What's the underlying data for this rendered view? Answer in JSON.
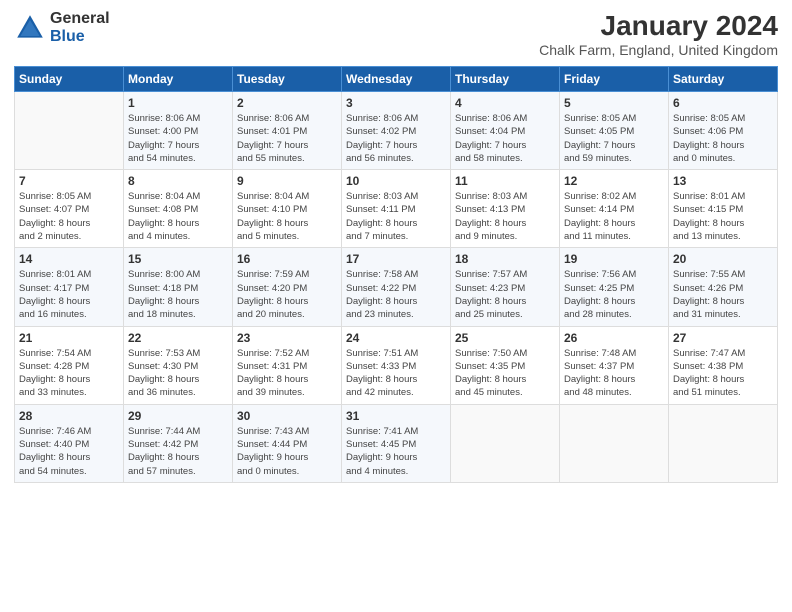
{
  "logo": {
    "general": "General",
    "blue": "Blue"
  },
  "header": {
    "title": "January 2024",
    "subtitle": "Chalk Farm, England, United Kingdom"
  },
  "weekdays": [
    "Sunday",
    "Monday",
    "Tuesday",
    "Wednesday",
    "Thursday",
    "Friday",
    "Saturday"
  ],
  "weeks": [
    [
      {
        "day": "",
        "sunrise": "",
        "sunset": "",
        "daylight": ""
      },
      {
        "day": "1",
        "sunrise": "Sunrise: 8:06 AM",
        "sunset": "Sunset: 4:00 PM",
        "daylight": "Daylight: 7 hours and 54 minutes."
      },
      {
        "day": "2",
        "sunrise": "Sunrise: 8:06 AM",
        "sunset": "Sunset: 4:01 PM",
        "daylight": "Daylight: 7 hours and 55 minutes."
      },
      {
        "day": "3",
        "sunrise": "Sunrise: 8:06 AM",
        "sunset": "Sunset: 4:02 PM",
        "daylight": "Daylight: 7 hours and 56 minutes."
      },
      {
        "day": "4",
        "sunrise": "Sunrise: 8:06 AM",
        "sunset": "Sunset: 4:04 PM",
        "daylight": "Daylight: 7 hours and 58 minutes."
      },
      {
        "day": "5",
        "sunrise": "Sunrise: 8:05 AM",
        "sunset": "Sunset: 4:05 PM",
        "daylight": "Daylight: 7 hours and 59 minutes."
      },
      {
        "day": "6",
        "sunrise": "Sunrise: 8:05 AM",
        "sunset": "Sunset: 4:06 PM",
        "daylight": "Daylight: 8 hours and 0 minutes."
      }
    ],
    [
      {
        "day": "7",
        "sunrise": "Sunrise: 8:05 AM",
        "sunset": "Sunset: 4:07 PM",
        "daylight": "Daylight: 8 hours and 2 minutes."
      },
      {
        "day": "8",
        "sunrise": "Sunrise: 8:04 AM",
        "sunset": "Sunset: 4:08 PM",
        "daylight": "Daylight: 8 hours and 4 minutes."
      },
      {
        "day": "9",
        "sunrise": "Sunrise: 8:04 AM",
        "sunset": "Sunset: 4:10 PM",
        "daylight": "Daylight: 8 hours and 5 minutes."
      },
      {
        "day": "10",
        "sunrise": "Sunrise: 8:03 AM",
        "sunset": "Sunset: 4:11 PM",
        "daylight": "Daylight: 8 hours and 7 minutes."
      },
      {
        "day": "11",
        "sunrise": "Sunrise: 8:03 AM",
        "sunset": "Sunset: 4:13 PM",
        "daylight": "Daylight: 8 hours and 9 minutes."
      },
      {
        "day": "12",
        "sunrise": "Sunrise: 8:02 AM",
        "sunset": "Sunset: 4:14 PM",
        "daylight": "Daylight: 8 hours and 11 minutes."
      },
      {
        "day": "13",
        "sunrise": "Sunrise: 8:01 AM",
        "sunset": "Sunset: 4:15 PM",
        "daylight": "Daylight: 8 hours and 13 minutes."
      }
    ],
    [
      {
        "day": "14",
        "sunrise": "Sunrise: 8:01 AM",
        "sunset": "Sunset: 4:17 PM",
        "daylight": "Daylight: 8 hours and 16 minutes."
      },
      {
        "day": "15",
        "sunrise": "Sunrise: 8:00 AM",
        "sunset": "Sunset: 4:18 PM",
        "daylight": "Daylight: 8 hours and 18 minutes."
      },
      {
        "day": "16",
        "sunrise": "Sunrise: 7:59 AM",
        "sunset": "Sunset: 4:20 PM",
        "daylight": "Daylight: 8 hours and 20 minutes."
      },
      {
        "day": "17",
        "sunrise": "Sunrise: 7:58 AM",
        "sunset": "Sunset: 4:22 PM",
        "daylight": "Daylight: 8 hours and 23 minutes."
      },
      {
        "day": "18",
        "sunrise": "Sunrise: 7:57 AM",
        "sunset": "Sunset: 4:23 PM",
        "daylight": "Daylight: 8 hours and 25 minutes."
      },
      {
        "day": "19",
        "sunrise": "Sunrise: 7:56 AM",
        "sunset": "Sunset: 4:25 PM",
        "daylight": "Daylight: 8 hours and 28 minutes."
      },
      {
        "day": "20",
        "sunrise": "Sunrise: 7:55 AM",
        "sunset": "Sunset: 4:26 PM",
        "daylight": "Daylight: 8 hours and 31 minutes."
      }
    ],
    [
      {
        "day": "21",
        "sunrise": "Sunrise: 7:54 AM",
        "sunset": "Sunset: 4:28 PM",
        "daylight": "Daylight: 8 hours and 33 minutes."
      },
      {
        "day": "22",
        "sunrise": "Sunrise: 7:53 AM",
        "sunset": "Sunset: 4:30 PM",
        "daylight": "Daylight: 8 hours and 36 minutes."
      },
      {
        "day": "23",
        "sunrise": "Sunrise: 7:52 AM",
        "sunset": "Sunset: 4:31 PM",
        "daylight": "Daylight: 8 hours and 39 minutes."
      },
      {
        "day": "24",
        "sunrise": "Sunrise: 7:51 AM",
        "sunset": "Sunset: 4:33 PM",
        "daylight": "Daylight: 8 hours and 42 minutes."
      },
      {
        "day": "25",
        "sunrise": "Sunrise: 7:50 AM",
        "sunset": "Sunset: 4:35 PM",
        "daylight": "Daylight: 8 hours and 45 minutes."
      },
      {
        "day": "26",
        "sunrise": "Sunrise: 7:48 AM",
        "sunset": "Sunset: 4:37 PM",
        "daylight": "Daylight: 8 hours and 48 minutes."
      },
      {
        "day": "27",
        "sunrise": "Sunrise: 7:47 AM",
        "sunset": "Sunset: 4:38 PM",
        "daylight": "Daylight: 8 hours and 51 minutes."
      }
    ],
    [
      {
        "day": "28",
        "sunrise": "Sunrise: 7:46 AM",
        "sunset": "Sunset: 4:40 PM",
        "daylight": "Daylight: 8 hours and 54 minutes."
      },
      {
        "day": "29",
        "sunrise": "Sunrise: 7:44 AM",
        "sunset": "Sunset: 4:42 PM",
        "daylight": "Daylight: 8 hours and 57 minutes."
      },
      {
        "day": "30",
        "sunrise": "Sunrise: 7:43 AM",
        "sunset": "Sunset: 4:44 PM",
        "daylight": "Daylight: 9 hours and 0 minutes."
      },
      {
        "day": "31",
        "sunrise": "Sunrise: 7:41 AM",
        "sunset": "Sunset: 4:45 PM",
        "daylight": "Daylight: 9 hours and 4 minutes."
      },
      {
        "day": "",
        "sunrise": "",
        "sunset": "",
        "daylight": ""
      },
      {
        "day": "",
        "sunrise": "",
        "sunset": "",
        "daylight": ""
      },
      {
        "day": "",
        "sunrise": "",
        "sunset": "",
        "daylight": ""
      }
    ]
  ]
}
